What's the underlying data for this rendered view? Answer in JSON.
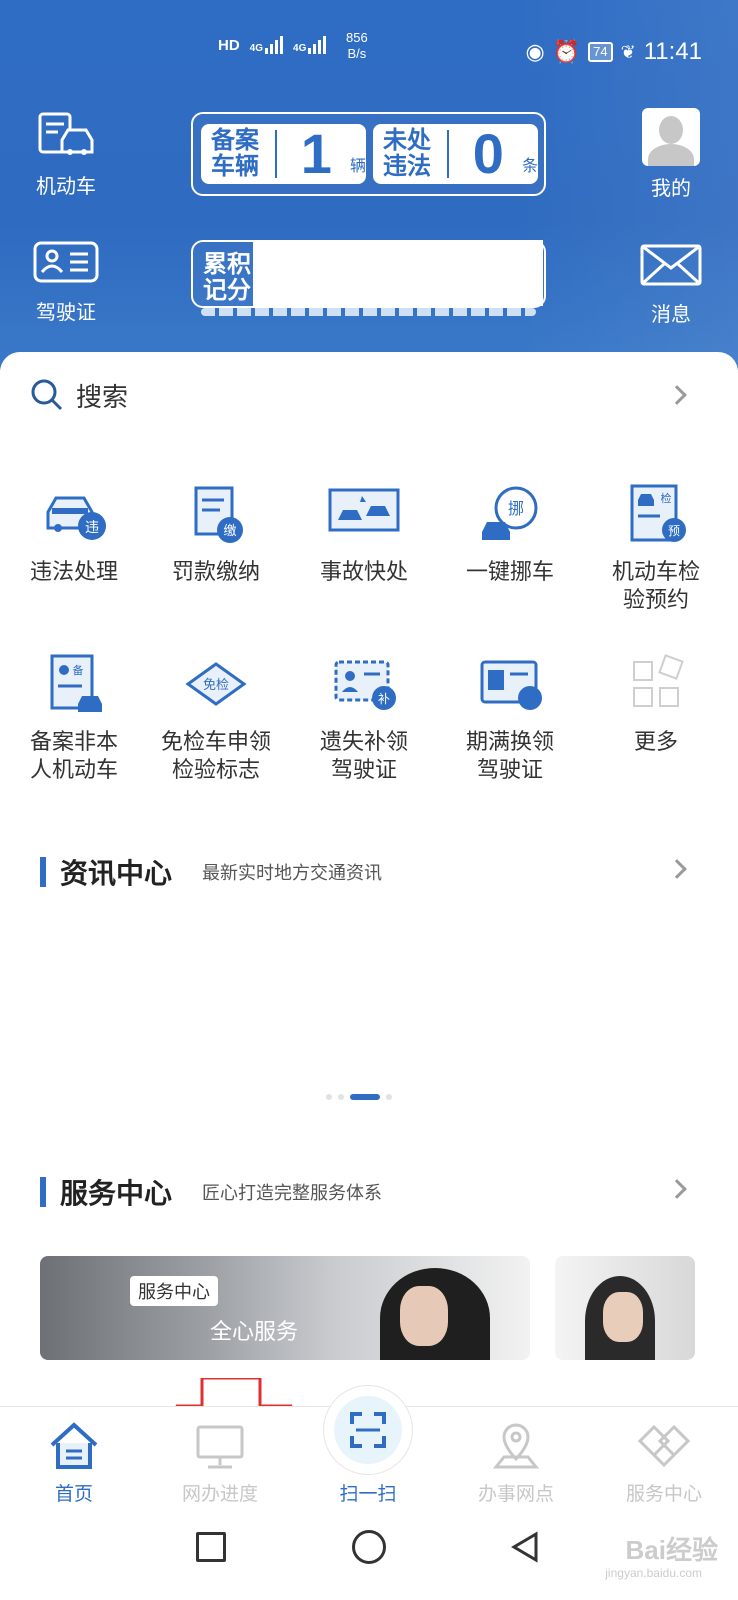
{
  "status_bar": {
    "hd": "HD",
    "net1": "4G",
    "net2": "4G",
    "speed_value": "856",
    "speed_unit": "B/s",
    "battery": "74",
    "time": "11:41"
  },
  "header": {
    "vehicle_label": "机动车",
    "license_label": "驾驶证",
    "profile_label": "我的",
    "message_label": "消息",
    "card1": {
      "left_label": "备案车辆",
      "left_value": "1",
      "left_unit": "辆",
      "right_label": "未处违法",
      "right_value": "0",
      "right_unit": "条"
    },
    "card2": {
      "label": "累积记分"
    }
  },
  "search": {
    "label": "搜索"
  },
  "services": [
    {
      "label": "违法处理",
      "icon": "car-violation-icon",
      "badge": "违"
    },
    {
      "label": "罚款缴纳",
      "icon": "fine-payment-icon",
      "badge": "缴"
    },
    {
      "label": "事故快处",
      "icon": "accident-icon"
    },
    {
      "label": "一键挪车",
      "icon": "move-car-icon",
      "badge": "挪"
    },
    {
      "label": "机动车检验预约",
      "icon": "inspection-appointment-icon",
      "badge": "预",
      "badge2": "检"
    },
    {
      "label": "备案非本人机动车",
      "icon": "register-vehicle-icon",
      "badge": "备"
    },
    {
      "label": "免检车申领检验标志",
      "icon": "exempt-inspection-icon",
      "badge": "免检"
    },
    {
      "label": "遗失补领驾驶证",
      "icon": "reissue-license-icon",
      "badge": "补"
    },
    {
      "label": "期满换领驾驶证",
      "icon": "renew-license-icon"
    },
    {
      "label": "更多",
      "icon": "more-icon"
    }
  ],
  "news": {
    "title": "资讯中心",
    "subtitle": "最新实时地方交通资讯"
  },
  "service_center": {
    "title": "服务中心",
    "subtitle": "匠心打造完整服务体系",
    "banner_tag": "服务中心",
    "banner_text": "全心服务"
  },
  "tabs": [
    {
      "label": "首页",
      "icon": "home-icon",
      "active": true
    },
    {
      "label": "网办进度",
      "icon": "monitor-icon"
    },
    {
      "label": "扫一扫",
      "icon": "scan-icon"
    },
    {
      "label": "办事网点",
      "icon": "location-icon"
    },
    {
      "label": "服务中心",
      "icon": "service-center-icon"
    }
  ],
  "watermark": {
    "brand": "Bai经验",
    "url": "jingyan.baidu.com"
  },
  "colors": {
    "primary": "#2f6dc4",
    "inactive": "#c7c7c7"
  }
}
